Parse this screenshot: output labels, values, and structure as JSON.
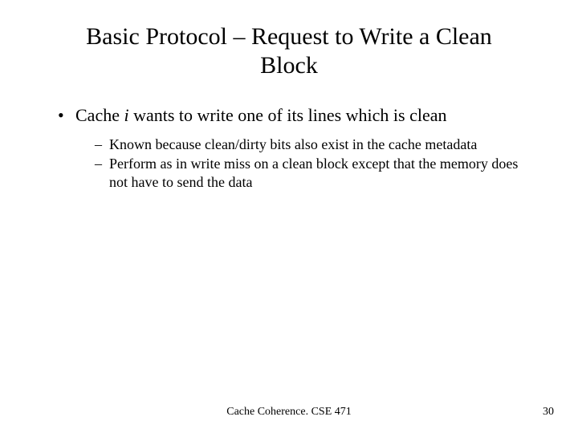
{
  "title": "Basic Protocol – Request to Write a Clean Block",
  "bullet1_pre": "Cache ",
  "bullet1_var": "i",
  "bullet1_post": "  wants to write one of its lines which is clean",
  "sub1": "Known because clean/dirty bits also exist in the cache metadata",
  "sub2": "Perform as in write miss on a clean block except that the memory does not have to send the data",
  "footer_center": "Cache Coherence.  CSE 471",
  "footer_right": "30"
}
